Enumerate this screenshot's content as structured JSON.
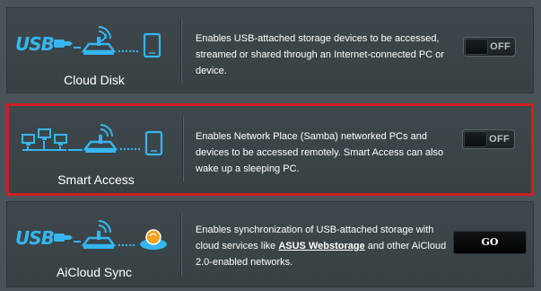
{
  "features": [
    {
      "title": "Cloud Disk",
      "description": "Enables USB-attached storage devices to be accessed, streamed or shared through an Internet-connected PC or device.",
      "control": {
        "type": "toggle",
        "label": "OFF",
        "state": "off"
      },
      "icons": [
        "usb-logo-icon",
        "router-icon",
        "phone-icon"
      ]
    },
    {
      "title": "Smart Access",
      "description": "Enables Network Place (Samba) networked PCs and devices to be accessed remotely. Smart Access can also wake up a sleeping PC.",
      "control": {
        "type": "toggle",
        "label": "OFF",
        "state": "off"
      },
      "highlighted": true,
      "icons": [
        "network-computers-icon",
        "router-icon",
        "phone-icon"
      ]
    },
    {
      "title": "AiCloud Sync",
      "description_before": "Enables synchronization of USB-attached storage with cloud services like ",
      "description_link": "ASUS Webstorage",
      "description_after": " and other AiCloud 2.0-enabled networks.",
      "control": {
        "type": "button",
        "label": "GO"
      },
      "icons": [
        "usb-logo-icon",
        "router-icon",
        "cloud-sync-icon"
      ]
    }
  ],
  "colors": {
    "background": "#4a5357",
    "row": "#3e474b",
    "highlight_border": "#cf1f23",
    "icon_blue": "#35b6f0"
  }
}
